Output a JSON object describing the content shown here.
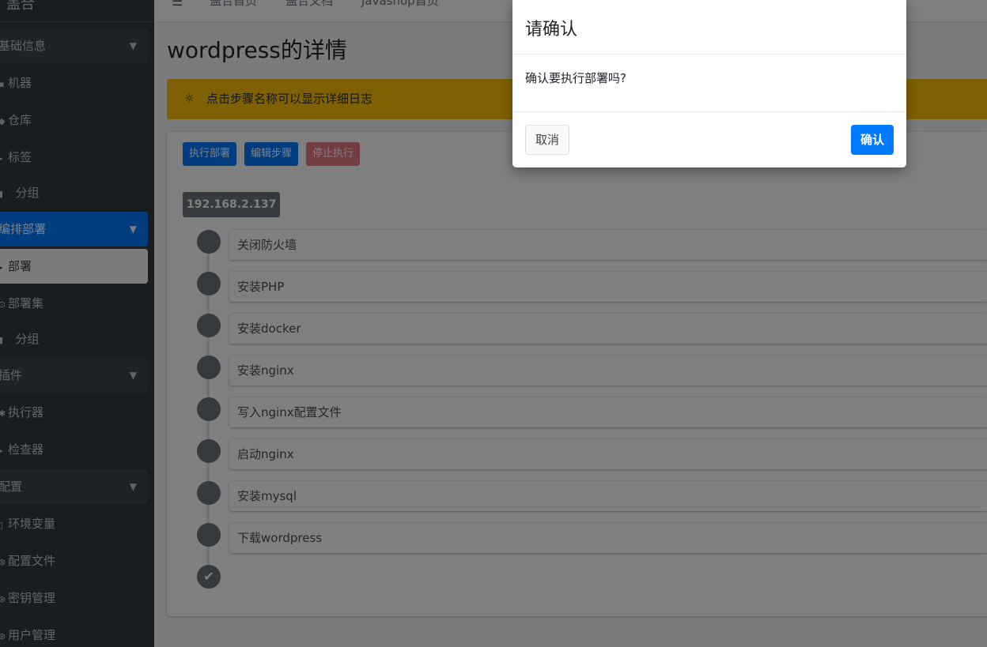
{
  "sidebar": {
    "brand": "盖合",
    "groups": [
      {
        "label": "基础信息",
        "items": [
          "机器",
          "仓库",
          "标签",
          "分组"
        ]
      },
      {
        "label": "编排部署",
        "items": [
          "部署",
          "部署集",
          "分组"
        ]
      },
      {
        "label": "插件",
        "items": [
          "执行器",
          "检查器"
        ]
      },
      {
        "label": "配置",
        "items": [
          "环境变量",
          "配置文件",
          "密钥管理",
          "用户管理"
        ]
      }
    ],
    "active_group": "编排部署",
    "active_item": "部署"
  },
  "topbar": {
    "links": [
      "盖合首页",
      "盖合文档",
      "Javashop首页"
    ]
  },
  "page": {
    "title": "wordpress的详情",
    "tip": "点击步骤名称可以显示详细日志",
    "buttons": {
      "deploy": "执行部署",
      "edit": "编辑步骤",
      "stop": "停止执行"
    },
    "host": "192.168.2.137",
    "steps": [
      "关闭防火墙",
      "安装PHP",
      "安装docker",
      "安装nginx",
      "写入nginx配置文件",
      "启动nginx",
      "安装mysql",
      "下载wordpress"
    ]
  },
  "modal": {
    "title": "请确认",
    "message": "确认要执行部署吗?",
    "cancel_label": "取消",
    "ok_label": "确认"
  },
  "colors": {
    "sidebar_bg": "#343a40",
    "primary": "#007bff",
    "warning": "#ffc107",
    "danger": "#dc3545"
  }
}
